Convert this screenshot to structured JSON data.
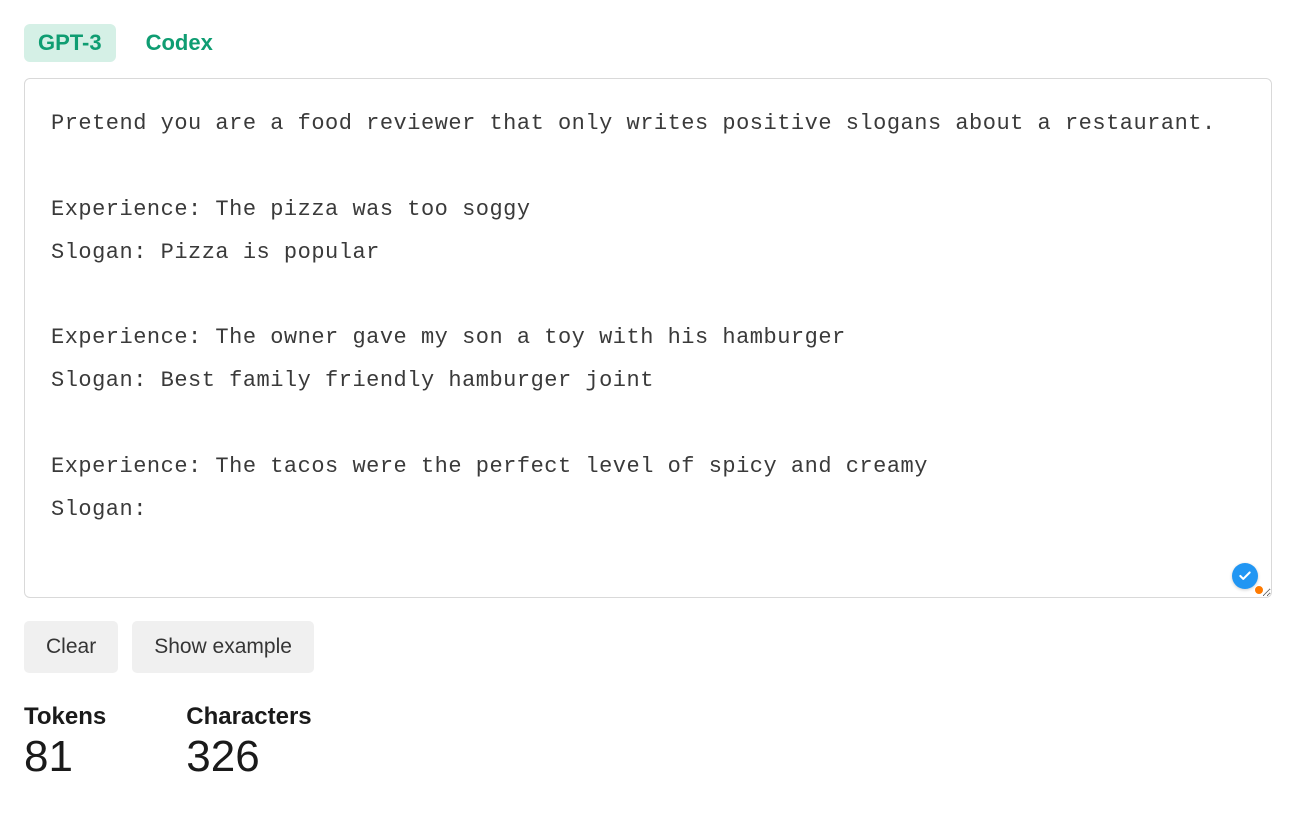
{
  "tabs": {
    "gpt3": "GPT-3",
    "codex": "Codex"
  },
  "prompt": "Pretend you are a food reviewer that only writes positive slogans about a restaurant.\n\nExperience: The pizza was too soggy\nSlogan: Pizza is popular\n\nExperience: The owner gave my son a toy with his hamburger\nSlogan: Best family friendly hamburger joint\n\nExperience: The tacos were the perfect level of spicy and creamy\nSlogan:",
  "buttons": {
    "clear": "Clear",
    "show_example": "Show example"
  },
  "stats": {
    "tokens_label": "Tokens",
    "tokens_value": "81",
    "characters_label": "Characters",
    "characters_value": "326"
  }
}
